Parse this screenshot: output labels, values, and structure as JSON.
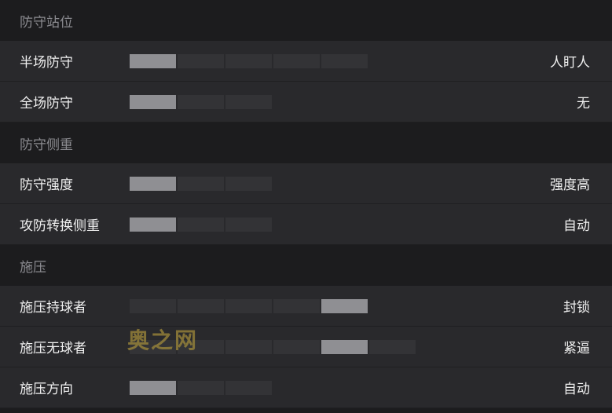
{
  "sections": [
    {
      "title": "防守站位",
      "rows": [
        {
          "label": "半场防守",
          "value": "人盯人",
          "level": 1,
          "segments": 5
        },
        {
          "label": "全场防守",
          "value": "无",
          "level": 1,
          "segments": 3
        }
      ]
    },
    {
      "title": "防守侧重",
      "rows": [
        {
          "label": "防守强度",
          "value": "强度高",
          "level": 1,
          "segments": 3
        },
        {
          "label": "攻防转换侧重",
          "value": "自动",
          "level": 1,
          "segments": 3
        }
      ]
    },
    {
      "title": "施压",
      "rows": [
        {
          "label": "施压持球者",
          "value": "封锁",
          "level": 5,
          "segments": 5
        },
        {
          "label": "施压无球者",
          "value": "紧逼",
          "level": 5,
          "segments": 6
        },
        {
          "label": "施压方向",
          "value": "自动",
          "level": 1,
          "segments": 3
        }
      ]
    }
  ],
  "watermark": "奥之网"
}
